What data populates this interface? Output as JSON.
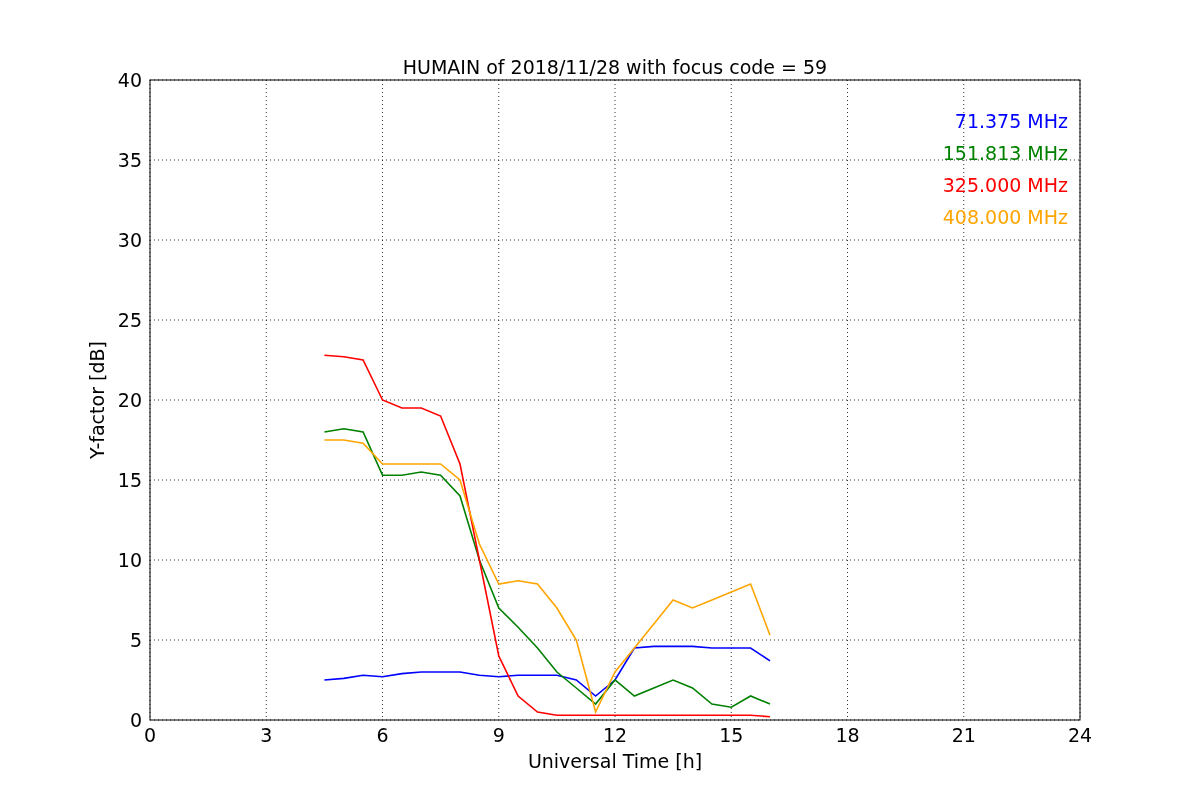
{
  "chart_data": {
    "type": "line",
    "title": "HUMAIN of 2018/11/28 with focus code = 59",
    "xlabel": "Universal Time [h]",
    "ylabel": "Y-factor [dB]",
    "x": [
      4.5,
      5,
      5.5,
      6,
      6.5,
      7,
      7.5,
      8,
      8.5,
      9,
      9.5,
      10,
      10.5,
      11,
      11.5,
      12,
      12.5,
      13,
      13.5,
      14,
      14.5,
      15,
      15.5,
      16
    ],
    "series": [
      {
        "name": "71.375 MHz",
        "color": "#0000ff",
        "values": [
          2.5,
          2.6,
          2.8,
          2.7,
          2.9,
          3.0,
          3.0,
          3.0,
          2.8,
          2.7,
          2.8,
          2.8,
          2.8,
          2.5,
          1.5,
          2.5,
          4.5,
          4.6,
          4.6,
          4.6,
          4.5,
          4.5,
          4.5,
          3.7
        ]
      },
      {
        "name": "151.813 MHz",
        "color": "#008000",
        "values": [
          18,
          18.2,
          18,
          15.3,
          15.3,
          15.5,
          15.3,
          14,
          10,
          7,
          5.8,
          4.5,
          3,
          2,
          1,
          2.5,
          1.5,
          2,
          2.5,
          2,
          1,
          0.8,
          1.5,
          1
        ]
      },
      {
        "name": "325.000 MHz",
        "color": "#ff0000",
        "values": [
          22.8,
          22.7,
          22.5,
          20,
          19.5,
          19.5,
          19,
          16,
          10,
          4,
          1.5,
          0.5,
          0.3,
          0.3,
          0.3,
          0.3,
          0.3,
          0.3,
          0.3,
          0.3,
          0.3,
          0.3,
          0.3,
          0.2
        ]
      },
      {
        "name": "408.000 MHz",
        "color": "#ffa500",
        "values": [
          17.5,
          17.5,
          17.3,
          16,
          16,
          16,
          16,
          15,
          11,
          8.5,
          8.7,
          8.5,
          7,
          5,
          0.5,
          3,
          4.5,
          6,
          7.5,
          7,
          7.5,
          8,
          8.5,
          5.3
        ]
      }
    ],
    "grid": true,
    "xlim": [
      0,
      24
    ],
    "ylim": [
      0,
      40
    ],
    "xticks": [
      0,
      3,
      6,
      9,
      12,
      15,
      18,
      21,
      24
    ],
    "yticks": [
      0,
      5,
      10,
      15,
      20,
      25,
      30,
      35,
      40
    ]
  }
}
